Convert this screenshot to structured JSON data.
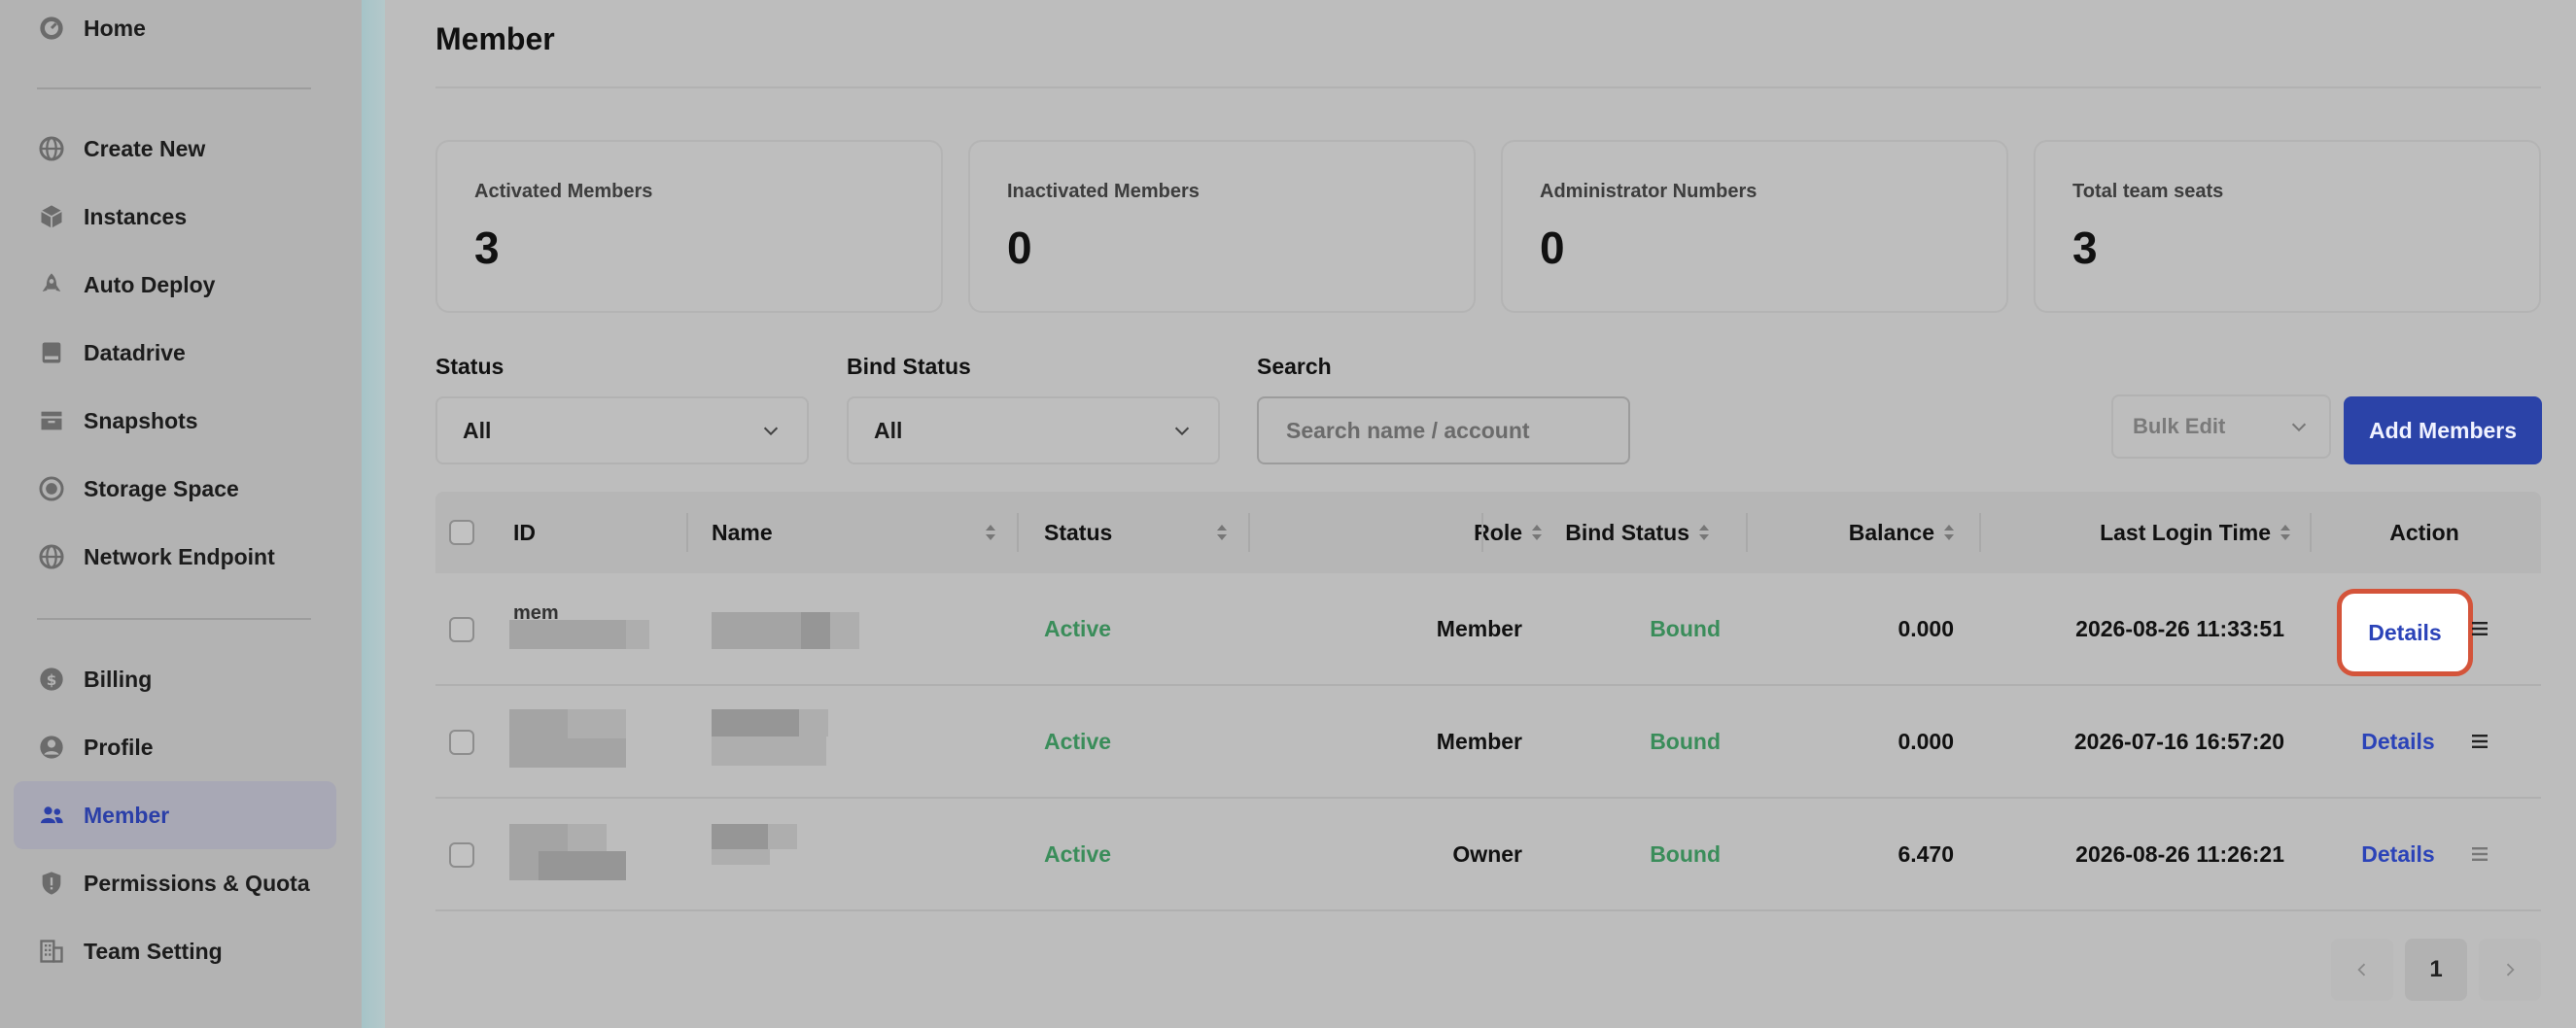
{
  "sidebar": {
    "items": [
      {
        "label": "Home",
        "icon": "home-icon"
      },
      {
        "label": "Create New",
        "icon": "globe-icon"
      },
      {
        "label": "Instances",
        "icon": "cube-icon"
      },
      {
        "label": "Auto Deploy",
        "icon": "rocket-icon"
      },
      {
        "label": "Datadrive",
        "icon": "drive-icon"
      },
      {
        "label": "Snapshots",
        "icon": "snapshot-icon"
      },
      {
        "label": "Storage Space",
        "icon": "storage-icon"
      },
      {
        "label": "Network Endpoint",
        "icon": "network-icon"
      },
      {
        "label": "Billing",
        "icon": "billing-icon"
      },
      {
        "label": "Profile",
        "icon": "profile-icon"
      },
      {
        "label": "Member",
        "icon": "members-icon",
        "active": true
      },
      {
        "label": "Permissions & Quota",
        "icon": "shield-icon"
      },
      {
        "label": "Team Setting",
        "icon": "building-icon"
      }
    ]
  },
  "page": {
    "title": "Member"
  },
  "stats": [
    {
      "label": "Activated Members",
      "value": "3"
    },
    {
      "label": "Inactivated Members",
      "value": "0"
    },
    {
      "label": "Administrator Numbers",
      "value": "0"
    },
    {
      "label": "Total team seats",
      "value": "3"
    }
  ],
  "filters": {
    "status": {
      "label": "Status",
      "value": "All"
    },
    "bind_status": {
      "label": "Bind Status",
      "value": "All"
    },
    "search": {
      "label": "Search",
      "placeholder": "Search name / account"
    }
  },
  "actions": {
    "bulk_edit": "Bulk Edit",
    "add_members": "Add Members"
  },
  "table": {
    "columns": [
      "ID",
      "Name",
      "Status",
      "Role",
      "Bind Status",
      "Balance",
      "Last Login Time",
      "Action"
    ],
    "rows": [
      {
        "id": "mem",
        "status": "Active",
        "role": "Member",
        "bind_status": "Bound",
        "balance": "0.000",
        "last_login": "2026-08-26 11:33:51",
        "action": "Details"
      },
      {
        "id": "",
        "status": "Active",
        "role": "Member",
        "bind_status": "Bound",
        "balance": "0.000",
        "last_login": "2026-07-16 16:57:20",
        "action": "Details"
      },
      {
        "id": "",
        "status": "Active",
        "role": "Owner",
        "bind_status": "Bound",
        "balance": "6.470",
        "last_login": "2026-08-26 11:26:21",
        "action": "Details"
      }
    ]
  },
  "pagination": {
    "current_page": "1"
  },
  "colors": {
    "accent": "#2b43a8",
    "status_green": "#3a8d5a",
    "highlight": "#d4543a"
  }
}
